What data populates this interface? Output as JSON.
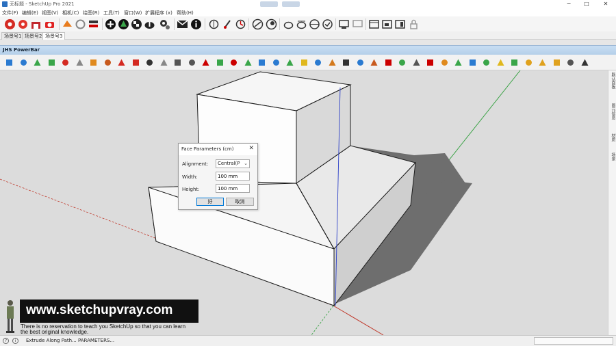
{
  "window": {
    "title": "无标题 - SketchUp Pro 2021",
    "controls": {
      "minimize": "−",
      "maximize": "□",
      "close": "✕"
    }
  },
  "menu": {
    "items": [
      "文件(F)",
      "编辑(E)",
      "视图(V)",
      "相机(C)",
      "绘图(R)",
      "工具(T)",
      "窗口(W)",
      "扩展程序 (x)",
      "帮助(H)"
    ]
  },
  "scenes": {
    "tabs": [
      "场景号1",
      "场景号2",
      "场景号3"
    ],
    "active_index": 2
  },
  "powerbar": {
    "title": "JHS PowerBar"
  },
  "right_panel": {
    "tabs": [
      "默认面板",
      "图元信息",
      "材质",
      "场景"
    ]
  },
  "dialog": {
    "title": "Face Parameters (cm)",
    "alignment_label": "Alignment:",
    "alignment_value": "Central(P",
    "width_label": "Width:",
    "width_value": "100 mm",
    "height_label": "Height:",
    "height_value": "100 mm",
    "ok_label": "好",
    "cancel_label": "取消"
  },
  "watermark": {
    "url": "www.sketchupvray.com",
    "line1": "There is no reservation to teach you SketchUp so that you can learn",
    "line2": "the best original knowledge."
  },
  "status": {
    "text": "Extrude Along Path... PARAMETERS..."
  },
  "colors": {
    "sky": "#dcdcdc",
    "axis_red": "#c0392b",
    "axis_green": "#2e9e3a",
    "axis_blue": "#2b3fc7",
    "pb_header": "#c8def3"
  }
}
